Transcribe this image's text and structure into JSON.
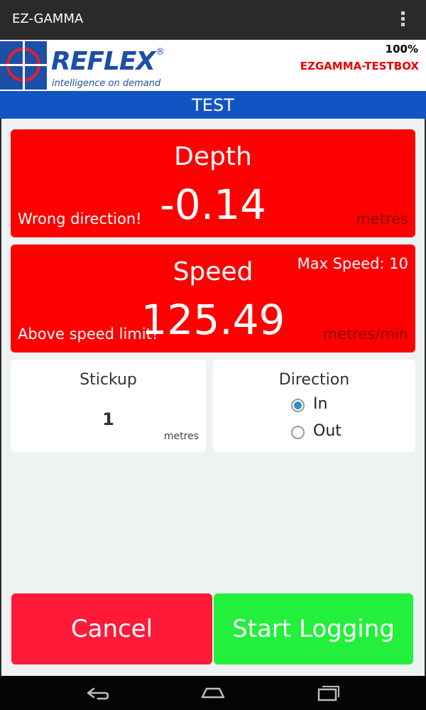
{
  "app": {
    "title": "EZ-GAMMA",
    "overflow_icon": "overflow-menu-icon"
  },
  "header": {
    "logo_text": "REFLEX",
    "logo_registered": "®",
    "logo_tagline": "intelligence on demand",
    "battery": "100%",
    "device_name": "EZGAMMA-TESTBOX"
  },
  "page_title": "TEST",
  "depth": {
    "label": "Depth",
    "value": "-0.14",
    "warning": "Wrong direction!",
    "unit": "metres"
  },
  "speed": {
    "label": "Speed",
    "value": "125.49",
    "warning": "Above speed limit!",
    "unit": "metres/min",
    "max": "Max Speed: 10"
  },
  "stickup": {
    "label": "Stickup",
    "value": "1",
    "unit": "metres"
  },
  "direction": {
    "label": "Direction",
    "options": [
      {
        "label": "In",
        "selected": true
      },
      {
        "label": "Out",
        "selected": false
      }
    ]
  },
  "buttons": {
    "cancel": "Cancel",
    "start": "Start Logging"
  },
  "colors": {
    "alert": "#ff0000",
    "title_bar": "#1155c4",
    "cancel": "#ff1a3a",
    "start": "#22f03c",
    "brand": "#1b4fa8"
  },
  "nav_icons": [
    "back-icon",
    "home-icon",
    "recents-icon"
  ]
}
